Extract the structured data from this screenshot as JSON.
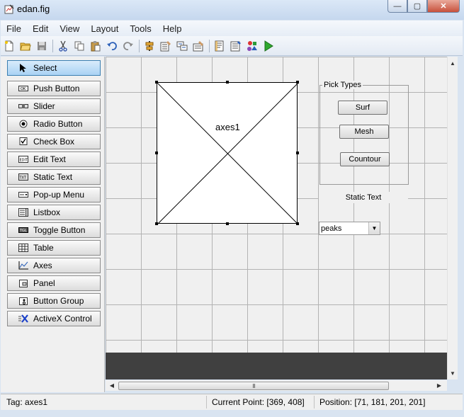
{
  "window": {
    "title": "edan.fig",
    "minimize": "—",
    "maximize": "▢",
    "close": "✕"
  },
  "menu": [
    "File",
    "Edit",
    "View",
    "Layout",
    "Tools",
    "Help"
  ],
  "toolbar": {
    "icons": [
      "new-file-icon",
      "open-folder-icon",
      "save-icon",
      "cut-icon",
      "copy-icon",
      "paste-icon",
      "undo-icon",
      "redo-icon",
      "align-icon",
      "menu-editor-icon",
      "tab-order-icon",
      "toolbar-editor-icon",
      "mfile-editor-icon",
      "property-inspector-icon",
      "object-browser-icon",
      "run-icon"
    ]
  },
  "palette": {
    "items": [
      {
        "label": "Select",
        "icon": "cursor-icon",
        "selected": true
      },
      {
        "label": "Push Button",
        "icon": "push-button-icon"
      },
      {
        "label": "Slider",
        "icon": "slider-icon"
      },
      {
        "label": "Radio Button",
        "icon": "radio-button-icon"
      },
      {
        "label": "Check Box",
        "icon": "check-box-icon"
      },
      {
        "label": "Edit Text",
        "icon": "edit-text-icon"
      },
      {
        "label": "Static Text",
        "icon": "static-text-icon"
      },
      {
        "label": "Pop-up Menu",
        "icon": "popup-menu-icon"
      },
      {
        "label": "Listbox",
        "icon": "listbox-icon"
      },
      {
        "label": "Toggle Button",
        "icon": "toggle-button-icon"
      },
      {
        "label": "Table",
        "icon": "table-icon"
      },
      {
        "label": "Axes",
        "icon": "axes-icon"
      },
      {
        "label": "Panel",
        "icon": "panel-icon"
      },
      {
        "label": "Button Group",
        "icon": "button-group-icon"
      },
      {
        "label": "ActiveX Control",
        "icon": "activex-icon"
      }
    ]
  },
  "canvas": {
    "axes_label": "axes1",
    "panel_title": "Pick Types",
    "buttons": [
      "Surf",
      "Mesh",
      "Countour"
    ],
    "static_text": "Static Text",
    "popup": {
      "value": "peaks"
    },
    "scroll_grip": "III"
  },
  "status": {
    "tag": "Tag: axes1",
    "current_point": "Current Point:  [369, 408]",
    "position": "Position: [71, 181, 201, 201]"
  }
}
